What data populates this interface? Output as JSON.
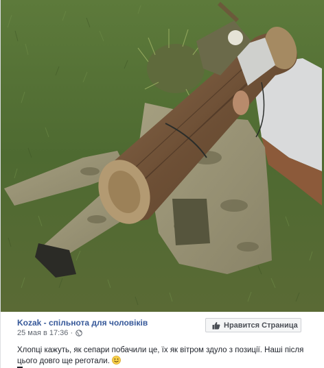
{
  "post": {
    "page_name": "Kozak - спільнота для чоловіків",
    "timestamp": "25 мая в 17:36 ·",
    "privacy_icon": "globe-icon",
    "like_button_label": "Нравится Страница",
    "like_button_icon": "thumb-up-icon",
    "text": "Хлопці кажуть, як сепари побачили це, їх як вітром здуло з позиції. Наші після цього довго ще реготали.",
    "emoji_icon": "smile-icon"
  },
  "colors": {
    "link": "#365899",
    "text": "#1d2129",
    "muted": "#616770",
    "grass": "#4f6b32",
    "log": "#7a5a3c"
  }
}
